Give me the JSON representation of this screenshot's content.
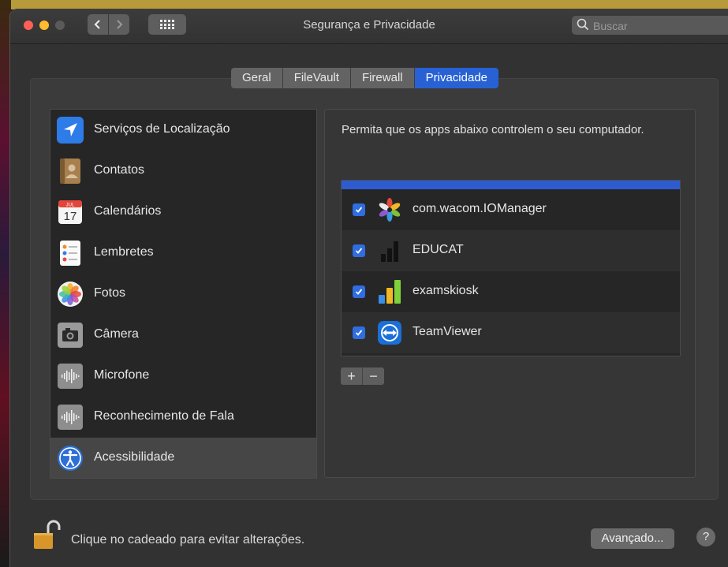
{
  "window": {
    "title": "Segurança e Privacidade"
  },
  "search": {
    "placeholder": "Buscar"
  },
  "tabs": [
    {
      "label": "Geral",
      "active": false
    },
    {
      "label": "FileVault",
      "active": false
    },
    {
      "label": "Firewall",
      "active": false
    },
    {
      "label": "Privacidade",
      "active": true
    }
  ],
  "categories": [
    {
      "label": "Serviços de Localização",
      "icon": "location-arrow-icon"
    },
    {
      "label": "Contatos",
      "icon": "contacts-book-icon"
    },
    {
      "label": "Calendários",
      "icon": "calendar-icon",
      "calendar_month": "JUL",
      "calendar_day": "17"
    },
    {
      "label": "Lembretes",
      "icon": "reminders-icon"
    },
    {
      "label": "Fotos",
      "icon": "photos-flower-icon"
    },
    {
      "label": "Câmera",
      "icon": "camera-icon"
    },
    {
      "label": "Microfone",
      "icon": "microphone-waveform-icon"
    },
    {
      "label": "Reconhecimento de Fala",
      "icon": "speech-waveform-icon"
    },
    {
      "label": "Acessibilidade",
      "icon": "accessibility-icon",
      "selected": true
    }
  ],
  "pane": {
    "description": "Permita que os apps abaixo controlem o seu computador.",
    "apps": [
      {
        "name": "com.wacom.IOManager",
        "checked": true,
        "icon": "wacom-icon"
      },
      {
        "name": "EDUCAT",
        "checked": true,
        "icon": "educat-bars-icon"
      },
      {
        "name": "examskiosk",
        "checked": true,
        "icon": "examskiosk-bars-icon"
      },
      {
        "name": "TeamViewer",
        "checked": true,
        "icon": "teamviewer-icon"
      }
    ],
    "add_label": "+",
    "remove_label": "−"
  },
  "footer": {
    "lock_text": "Clique no cadeado para evitar alterações.",
    "advanced_label": "Avançado...",
    "help_label": "?"
  },
  "colors": {
    "accent": "#2761d4",
    "checkbox": "#2f6de1",
    "window_bg": "#323232"
  }
}
